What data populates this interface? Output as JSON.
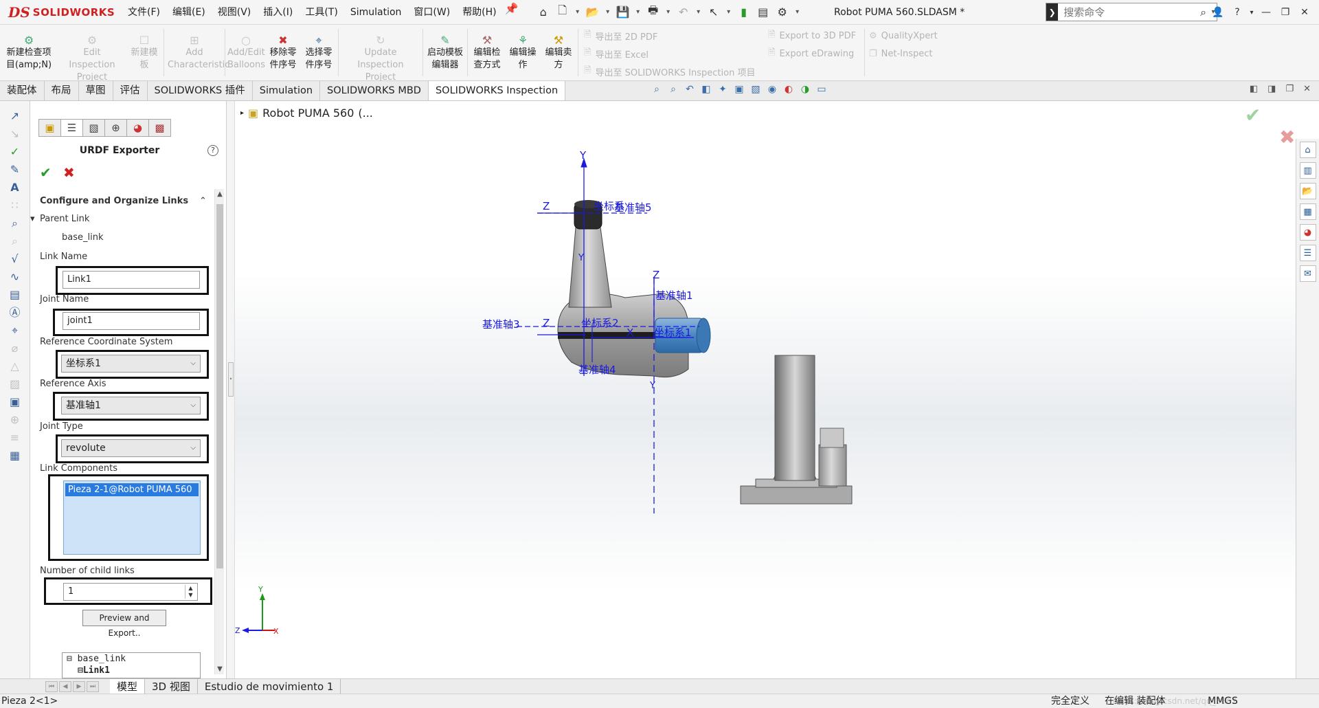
{
  "app": {
    "logo_ds": "DS",
    "logo_text": "SOLIDWORKS",
    "document_title": "Robot PUMA 560.SLDASM *"
  },
  "menu": [
    "文件(F)",
    "编辑(E)",
    "视图(V)",
    "插入(I)",
    "工具(T)",
    "Simulation",
    "窗口(W)",
    "帮助(H)"
  ],
  "search": {
    "placeholder": "搜索命令"
  },
  "ribbon": {
    "new_inspection": "新建检查项目(amp;N)",
    "edit_inspection": "Edit Inspection Project",
    "new_template": "新建模板",
    "add_characteristic": "Add Characteristic",
    "add_balloons": "Add/Edit Balloons",
    "remove_balloon": "移除零件序号",
    "select_balloon": "选择零件序号",
    "update_inspection": "Update Inspection Project",
    "launch_template": "启动模板编辑器",
    "edit_method": "编辑检查方式",
    "edit_operation": "编辑操作",
    "edit_vendor": "编辑卖方",
    "export_2d_pdf": "导出至 2D PDF",
    "export_excel": "导出至 Excel",
    "export_inspection": "导出至 SOLIDWORKS Inspection 项目",
    "export_3d_pdf": "Export to 3D PDF",
    "export_edrawing": "Export eDrawing",
    "qualityxpert": "QualityXpert",
    "net_inspect": "Net-Inspect"
  },
  "tabs": [
    "装配体",
    "布局",
    "草图",
    "评估",
    "SOLIDWORKS 插件",
    "Simulation",
    "SOLIDWORKS MBD",
    "SOLIDWORKS Inspection"
  ],
  "active_tab": "SOLIDWORKS Inspection",
  "tree_flyout": {
    "label": "Robot PUMA 560",
    "suffix": "(..."
  },
  "panel": {
    "title": "URDF Exporter",
    "help": "?",
    "group_title": "Configure and Organize Links",
    "parent_link_label": "Parent Link",
    "parent_link_value": "base_link",
    "link_name_label": "Link Name",
    "link_name_value": "Link1",
    "joint_name_label": "Joint Name",
    "joint_name_value": "joint1",
    "ref_cs_label": "Reference Coordinate System",
    "ref_cs_value": "坐标系1",
    "ref_axis_label": "Reference Axis",
    "ref_axis_value": "基准轴1",
    "joint_type_label": "Joint Type",
    "joint_type_value": "revolute",
    "link_components_label": "Link Components",
    "link_component_item": "Pieza 2-1@Robot PUMA 560",
    "num_child_label": "Number of child links",
    "num_child_value": "1",
    "preview_button": "Preview and Export..",
    "tree_root": "base_link",
    "tree_child": "Link1"
  },
  "viewport_labels": {
    "axis_y": "Y",
    "axis_z": "Z",
    "axis_x": "X",
    "datum_axis_5": "基准轴5",
    "datum_axis_1": "基准轴1",
    "datum_axis_3": "基准轴3",
    "datum_axis_4": "基准轴4",
    "coord_sys_2": "坐标系2",
    "coord_sys_1": "坐标系1",
    "coord_sys_top": "坐标系"
  },
  "bottom_tabs": [
    "模型",
    "3D 视图",
    "Estudio de movimiento 1"
  ],
  "active_bottom_tab": "模型",
  "status": {
    "left": "Pieza 2<1>",
    "defined": "完全定义",
    "editing": "在编辑 装配体",
    "units": "MMGS",
    "watermark": "https://blog.csdn.net/qq_3667"
  },
  "colors": {
    "accent_red": "#d02020",
    "axis_blue": "#1a1ae0",
    "ok_green": "#2a9a2a"
  }
}
